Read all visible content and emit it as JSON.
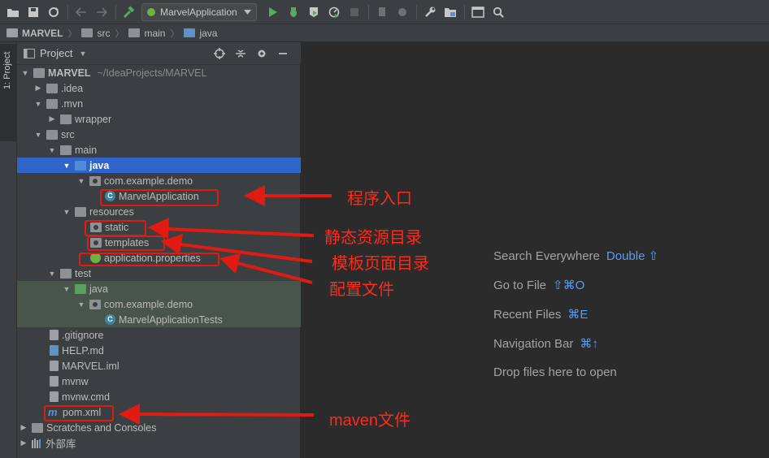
{
  "toolbar": {
    "run_config": "MarvelApplication",
    "icons": [
      "open-icon",
      "save-icon",
      "sync-icon",
      "back-icon",
      "forward-icon",
      "build-icon",
      "run-icon",
      "debug-icon",
      "coverage-icon",
      "profile-icon",
      "stop-icon",
      "attach-icon",
      "deploy-icon",
      "settings-icon",
      "project-structure-icon",
      "terminal-icon",
      "search-icon"
    ]
  },
  "breadcrumb": [
    "MARVEL",
    "src",
    "main",
    "java"
  ],
  "side_strip": {
    "project_tab": "1: Project"
  },
  "project_panel": {
    "title": "Project",
    "tree": [
      {
        "label": "MARVEL",
        "path": "~/IdeaProjects/MARVEL"
      },
      {
        "label": ".idea"
      },
      {
        "label": ".mvn"
      },
      {
        "label": "wrapper"
      },
      {
        "label": "src"
      },
      {
        "label": "main"
      },
      {
        "label": "java"
      },
      {
        "label": "com.example.demo"
      },
      {
        "label": "MarvelApplication"
      },
      {
        "label": "resources"
      },
      {
        "label": "static"
      },
      {
        "label": "templates"
      },
      {
        "label": "application.properties"
      },
      {
        "label": "test"
      },
      {
        "label": "java"
      },
      {
        "label": "com.example.demo"
      },
      {
        "label": "MarvelApplicationTests"
      },
      {
        "label": ".gitignore"
      },
      {
        "label": "HELP.md"
      },
      {
        "label": "MARVEL.iml"
      },
      {
        "label": "mvnw"
      },
      {
        "label": "mvnw.cmd"
      },
      {
        "label": "pom.xml"
      },
      {
        "label": "Scratches and Consoles"
      },
      {
        "label": "外部库"
      }
    ]
  },
  "editor": {
    "hints": [
      {
        "label": "Search Everywhere",
        "key": "Double ⇧"
      },
      {
        "label": "Go to File",
        "key": "⇧⌘O"
      },
      {
        "label": "Recent Files",
        "key": "⌘E"
      },
      {
        "label": "Navigation Bar",
        "key": "⌘↑"
      },
      {
        "label": "Drop files here to open",
        "key": ""
      }
    ]
  },
  "annotations": {
    "entry": "程序入口",
    "static": "静态资源目录",
    "templates": "模板页面目录",
    "config": "配置文件",
    "maven": "maven文件"
  },
  "colors": {
    "annotation": "#ff2a1a",
    "selection": "#2f65ca",
    "shortcut": "#589df6",
    "test_bg": "#49544a"
  }
}
